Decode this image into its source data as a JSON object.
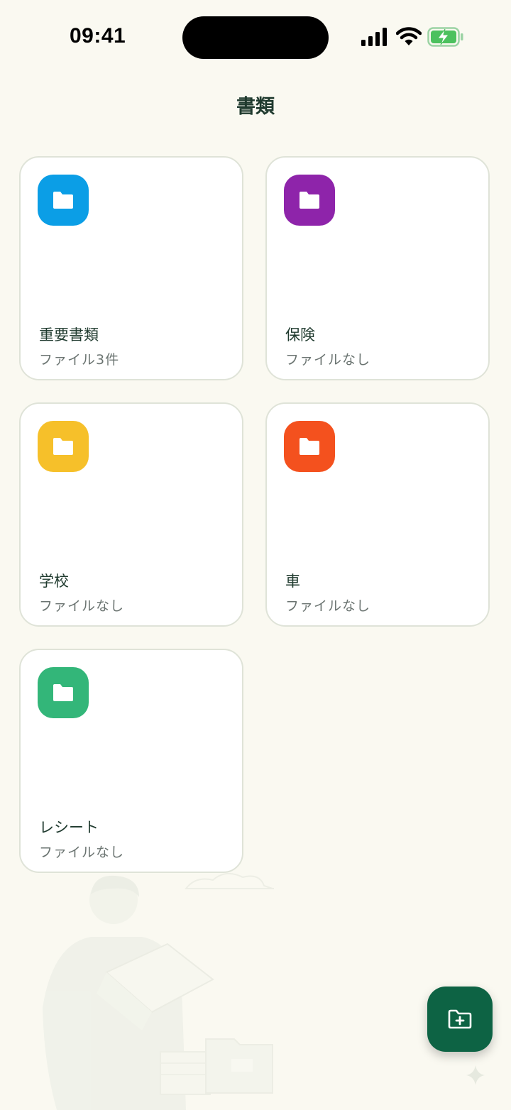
{
  "status_bar": {
    "time": "09:41"
  },
  "header": {
    "title": "書類"
  },
  "folders": [
    {
      "name": "重要書類",
      "count_label": "ファイル3件",
      "color": "#0b9ee6"
    },
    {
      "name": "保険",
      "count_label": "ファイルなし",
      "color": "#8e24aa"
    },
    {
      "name": "学校",
      "count_label": "ファイルなし",
      "color": "#f6c02a"
    },
    {
      "name": "車",
      "count_label": "ファイルなし",
      "color": "#f4511e"
    },
    {
      "name": "レシート",
      "count_label": "ファイルなし",
      "color": "#33b679"
    }
  ],
  "fab": {
    "icon": "folder-plus-icon",
    "color": "#0d6344"
  }
}
